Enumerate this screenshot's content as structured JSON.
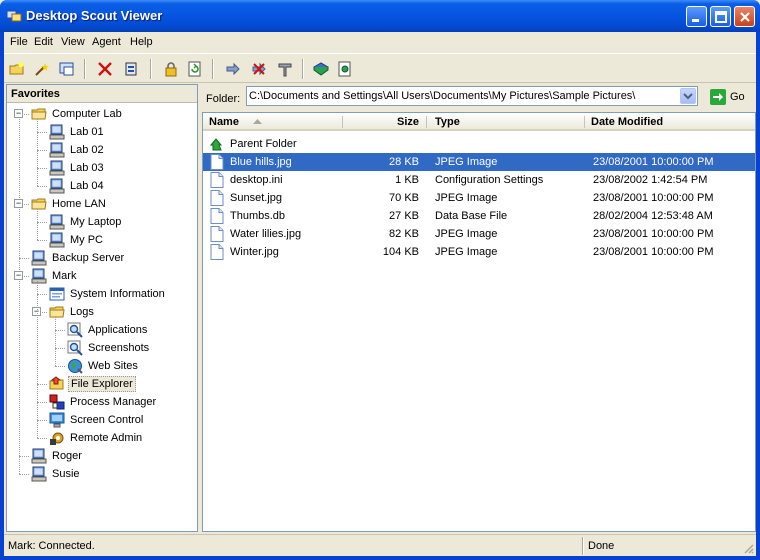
{
  "window": {
    "title": "Desktop Scout Viewer",
    "controls": [
      "minimize",
      "maximize",
      "close"
    ]
  },
  "menu": [
    "File",
    "Edit",
    "View",
    "Agent",
    "Help"
  ],
  "toolbar": {
    "icons": [
      "new-folder-icon",
      "wand-icon",
      "screenshot-icon",
      "delete-icon",
      "properties-icon",
      "lock-icon",
      "refresh-icon",
      "forward-icon",
      "disconnect-icon",
      "tools-icon",
      "help-book-icon",
      "about-icon"
    ]
  },
  "favorites": {
    "header": "Favorites",
    "items": [
      {
        "label": "Computer Lab",
        "icon": "folder-icon",
        "level": 0,
        "expanded": true
      },
      {
        "label": "Lab 01",
        "icon": "computer-icon",
        "level": 1
      },
      {
        "label": "Lab 02",
        "icon": "computer-icon",
        "level": 1
      },
      {
        "label": "Lab 03",
        "icon": "computer-icon",
        "level": 1
      },
      {
        "label": "Lab 04",
        "icon": "computer-icon",
        "level": 1
      },
      {
        "label": "Home LAN",
        "icon": "folder-icon",
        "level": 0,
        "expanded": true
      },
      {
        "label": "My Laptop",
        "icon": "computer-icon",
        "level": 1
      },
      {
        "label": "My PC",
        "icon": "computer-icon",
        "level": 1
      },
      {
        "label": "Backup Server",
        "icon": "computer-icon",
        "level": 0
      },
      {
        "label": "Mark",
        "icon": "computer-icon",
        "level": 0,
        "expanded": true
      },
      {
        "label": "System Information",
        "icon": "sysinfo-icon",
        "level": 1
      },
      {
        "label": "Logs",
        "icon": "folder-icon",
        "level": 1,
        "expanded": true
      },
      {
        "label": "Applications",
        "icon": "magnifier-icon",
        "level": 2
      },
      {
        "label": "Screenshots",
        "icon": "magnifier-icon",
        "level": 2
      },
      {
        "label": "Web Sites",
        "icon": "globe-icon",
        "level": 2
      },
      {
        "label": "File Explorer",
        "icon": "file-explorer-icon",
        "level": 1,
        "selected": true
      },
      {
        "label": "Process Manager",
        "icon": "process-icon",
        "level": 1
      },
      {
        "label": "Screen Control",
        "icon": "monitor-icon",
        "level": 1
      },
      {
        "label": "Remote Admin",
        "icon": "admin-icon",
        "level": 1
      },
      {
        "label": "Roger",
        "icon": "computer-icon",
        "level": 0
      },
      {
        "label": "Susie",
        "icon": "computer-icon",
        "level": 0
      }
    ]
  },
  "folder": {
    "label": "Folder:",
    "path": "C:\\Documents and Settings\\All Users\\Documents\\My Pictures\\Sample Pictures\\",
    "go_label": "Go"
  },
  "files": {
    "columns": {
      "name": "Name",
      "size": "Size",
      "type": "Type",
      "date": "Date Modified"
    },
    "parent": "Parent Folder",
    "rows": [
      {
        "name": "Blue hills.jpg",
        "size": "28 KB",
        "type": "JPEG Image",
        "date": "23/08/2001 10:00:00 PM",
        "selected": true
      },
      {
        "name": "desktop.ini",
        "size": "1 KB",
        "type": "Configuration Settings",
        "date": "23/08/2002 1:42:54 PM"
      },
      {
        "name": "Sunset.jpg",
        "size": "70 KB",
        "type": "JPEG Image",
        "date": "23/08/2001 10:00:00 PM"
      },
      {
        "name": "Thumbs.db",
        "size": "27 KB",
        "type": "Data Base File",
        "date": "28/02/2004 12:53:48 AM"
      },
      {
        "name": "Water lilies.jpg",
        "size": "82 KB",
        "type": "JPEG Image",
        "date": "23/08/2001 10:00:00 PM"
      },
      {
        "name": "Winter.jpg",
        "size": "104 KB",
        "type": "JPEG Image",
        "date": "23/08/2001 10:00:00 PM"
      }
    ]
  },
  "status": {
    "left": "Mark: Connected.",
    "right": "Done"
  },
  "colors": {
    "selection": "#316ac5",
    "titlebar": "#0655e0"
  }
}
